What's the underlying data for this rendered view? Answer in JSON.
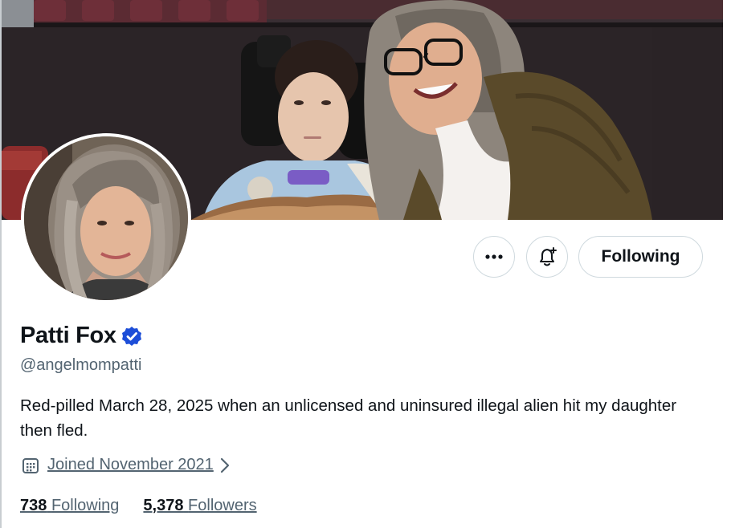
{
  "profile": {
    "display_name": "Patti Fox",
    "verified": true,
    "handle": "@angelmompatti",
    "bio": "Red-pilled March 28, 2025 when an unlicensed and uninsured illegal alien hit my daughter then fled.",
    "joined": "Joined November 2021"
  },
  "actions": {
    "more_label": "•••",
    "follow_label": "Following"
  },
  "stats": {
    "following_count": "738",
    "following_label": "Following",
    "followers_count": "5,378",
    "followers_label": "Followers"
  },
  "icons": {
    "more": "more-icon",
    "notify": "bell-plus-icon",
    "verified": "verified-badge-icon",
    "calendar": "calendar-icon",
    "chevron": "chevron-right-icon"
  },
  "colors": {
    "verified_badge": "#1d4ed8",
    "text_primary": "#0f1419",
    "text_secondary": "#536471",
    "button_border": "#cfd9de"
  }
}
